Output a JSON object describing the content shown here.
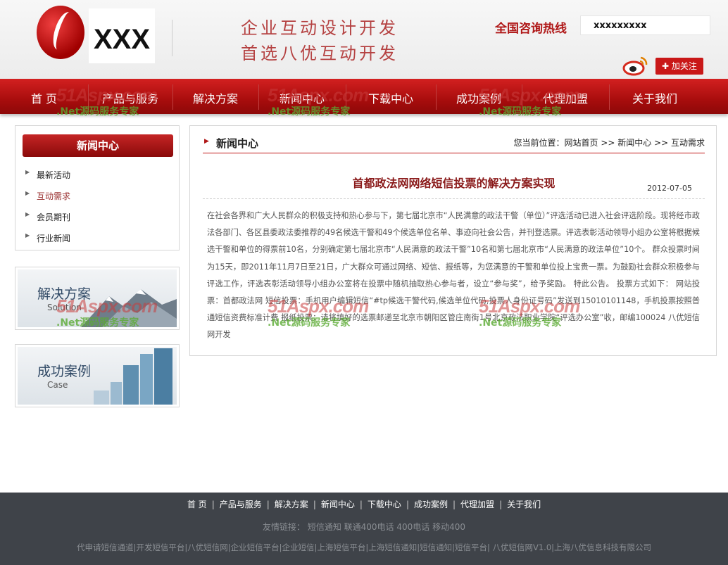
{
  "header": {
    "logo_text": "XXX",
    "slogan_line1": "企业互动设计开发",
    "slogan_line2": "首选八优互动开发",
    "hotline_label": "全国咨询热线",
    "hotline_value": "xxxxxxxxx",
    "follow_label": "加关注"
  },
  "nav": {
    "items": [
      {
        "label": "首 页"
      },
      {
        "label": "产品与服务"
      },
      {
        "label": "解决方案"
      },
      {
        "label": "新闻中心"
      },
      {
        "label": "下载中心"
      },
      {
        "label": "成功案例"
      },
      {
        "label": "代理加盟"
      },
      {
        "label": "关于我们"
      }
    ]
  },
  "sidebar": {
    "news_title": "新闻中心",
    "items": [
      {
        "label": "最新活动"
      },
      {
        "label": "互动需求",
        "active": true
      },
      {
        "label": "会员期刊"
      },
      {
        "label": "行业新闻"
      }
    ],
    "solution_banner": {
      "title": "解决方案",
      "subtitle": "Solution"
    },
    "case_banner": {
      "title": "成功案例",
      "subtitle": "Case"
    }
  },
  "main": {
    "section_title": "新闻中心",
    "breadcrumb": "您当前位置：网站首页 >> 新闻中心 >> 互动需求",
    "article_title": "首都政法网网络短信投票的解决方案实现",
    "article_date": "2012-07-05",
    "article_body": "在社会各界和广大人民群众的积极支持和热心参与下，第七届北京市“人民满意的政法干警（单位）”评选活动已进入社会评选阶段。现将经市政法各部门、各区县委政法委推荐的49名候选干警和49个候选单位名单、事迹向社会公告，并刊登选票。评选表彰活动领导小组办公室将根据候选干警和单位的得票前10名，分别确定第七届北京市“人民满意的政法干警”10名和第七届北京市“人民满意的政法单位”10个。 群众投票时间为15天，即2011年11月7日至21日，广大群众可通过网络、短信、报纸等，为您满意的干警和单位投上宝贵一票。为鼓励社会群众积极参与评选工作，评选表彰活动领导小组办公室将在投票中随机抽取热心参与者，设立“参与奖”，给予奖励。 特此公告。 投票方式如下： 网站投票：首都政法网 短信投票：手机用户编辑短信“#tp候选干警代码,候选单位代码,投票人身份证号码”发送到15010101148，手机投票按照普通短信资费标准计费 报纸投票：请将填好的选票邮递至北京市朝阳区管庄南街1号北京政法职业学院“评选办公室”收，邮编100024 八优短信网开发"
  },
  "footer": {
    "nav": [
      "首 页",
      "产品与服务",
      "解决方案",
      "新闻中心",
      "下载中心",
      "成功案例",
      "代理加盟",
      "关于我们"
    ],
    "friend_links_label": "友情链接：",
    "friend_links": "短信通知 联通400电话 400电话 移动400",
    "links_line": "代申请短信通道|开发短信平台|八优短信网|企业短信平台|企业短信|上海短信平台|上海短信通知|短信通知|短信平台| 八优短信网V1.0|上海八优信息科技有限公司"
  },
  "watermark": {
    "logo": "51Aspx",
    "logo_suffix": ".com",
    "text": ".Net源码服务专家"
  },
  "colors": {
    "brand_red": "#c91818",
    "footer_bg": "#3f4349"
  }
}
